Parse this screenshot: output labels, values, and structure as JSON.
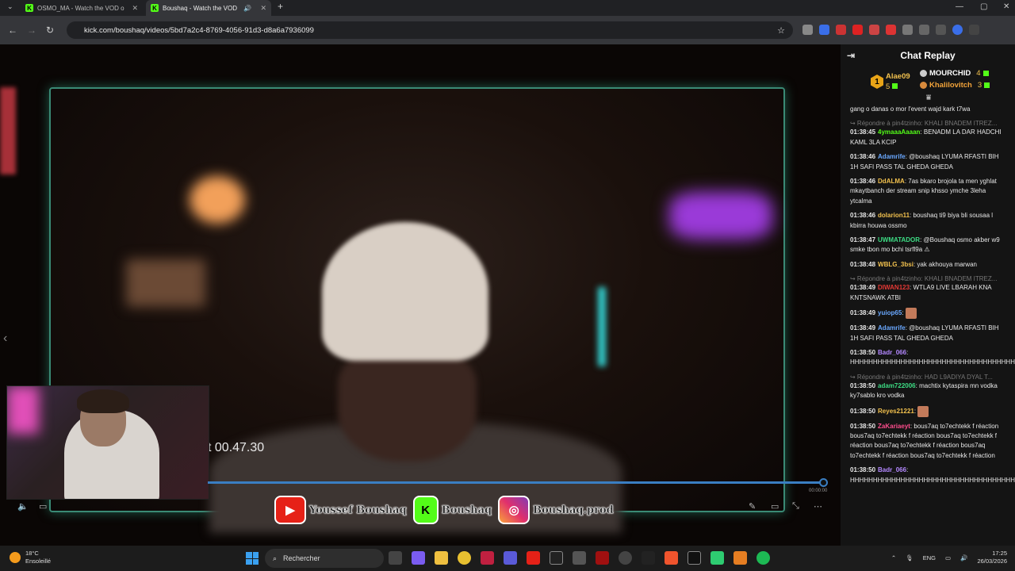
{
  "browser": {
    "tabs": [
      {
        "title": "OSMO_MA - Watch the VOD o",
        "active": false
      },
      {
        "title": "Boushaq - Watch the VOD",
        "active": true
      }
    ],
    "new_tab": "+",
    "url": "kick.com/boushaq/videos/5bd7a2c4-8769-4056-91d3-d8a6a7936099"
  },
  "video": {
    "timestamp_overlay": "t 00.47.30",
    "duration": "00:00:00",
    "social": [
      {
        "icon": "youtube-icon",
        "label": "Youssef Boushaq",
        "color": "#e62117"
      },
      {
        "icon": "kick-icon",
        "label": "Boushaq",
        "color": "#53fc18"
      },
      {
        "icon": "instagram-icon",
        "label": "Boushaq.prod",
        "color": "#c13584"
      }
    ]
  },
  "chat": {
    "title": "Chat Replay",
    "leaderboard": {
      "first": {
        "name": "Alae09",
        "count": "5",
        "rank": "1"
      },
      "second": {
        "name": "MOURCHID",
        "count": "4"
      },
      "third": {
        "name": "Khalilovitch",
        "count": "3"
      }
    },
    "messages": [
      {
        "ts": "",
        "user": "",
        "color": "#e8e8e8",
        "text": "gang o danas o mor l'event wajd kark t7wa",
        "reply": ""
      },
      {
        "ts": "01:38:45",
        "user": "4ymaaaAaaan",
        "color": "#53fc18",
        "text": "BENADM LA DAR HADCHI KAML 3LA KCIP",
        "reply": "↪ Répondre à pin4tzinho: KHALI BNADEM ITREZ..."
      },
      {
        "ts": "01:38:46",
        "user": "Adamrife",
        "color": "#6aa8ff",
        "text": "@boushaq LYUMA RFASTI BIH 1H SAFI PASS TAL GHEDA GHEDA",
        "reply": ""
      },
      {
        "ts": "01:38:46",
        "user": "DdALMA",
        "color": "#f2c14e",
        "text": "7as bkaro brojola ta men yghlat mkaytbanch der stream snip khsso ymche 3leha ytcalma",
        "reply": ""
      },
      {
        "ts": "01:38:46",
        "user": "dolarion11",
        "color": "#f2c14e",
        "text": "boushaq ti9 biya bli sousaa l kbirra houwa ossmo",
        "reply": ""
      },
      {
        "ts": "01:38:47",
        "user": "UWMATADOR",
        "color": "#3ddc84",
        "text": "@Boushaq osmo akber w9 smke tbon mo bchi tsrfl9a ⚠",
        "reply": ""
      },
      {
        "ts": "01:38:48",
        "user": "WBLG_3bsi",
        "color": "#f2c14e",
        "text": "yak akhouya marwan",
        "reply": ""
      },
      {
        "ts": "01:38:49",
        "user": "DIWAN123",
        "color": "#e53935",
        "text": "WTLA9 LIVE LBARAH KNA KNTSNAWK ATBI",
        "reply": "↪ Répondre à pin4tzinho: KHALI BNADEM ITREZ..."
      },
      {
        "ts": "01:38:49",
        "user": "yuiop65",
        "color": "#6aa8ff",
        "text": "",
        "reply": "",
        "emote": true
      },
      {
        "ts": "01:38:49",
        "user": "Adamrife",
        "color": "#6aa8ff",
        "text": "@boushaq LYUMA RFASTI BIH 1H SAFI PASS TAL GHEDA GHEDA",
        "reply": ""
      },
      {
        "ts": "01:38:50",
        "user": "Badr_066",
        "color": "#b388ff",
        "text": "HHHHHHHHHHHHHHHHHHHHHHHHHHHHHHHHHHHHHHHHHHHHHHJH",
        "reply": ""
      },
      {
        "ts": "01:38:50",
        "user": "adam722006",
        "color": "#3ddc84",
        "text": "machtix kytaspira mn vodka ky7sablo kro vodka",
        "reply": "↪ Répondre à pin4tzinho: HAD L9ADIYA DYAL T..."
      },
      {
        "ts": "01:38:50",
        "user": "Reyes21221",
        "color": "#f2c14e",
        "text": "",
        "reply": "",
        "emote": true
      },
      {
        "ts": "01:38:50",
        "user": "ZaKariaeyt",
        "color": "#ff4d8d",
        "text": "bous7aq to7echtekk f réaction bous7aq to7echtekk f réaction bous7aq to7echtekk f réaction bous7aq to7echtekk f réaction bous7aq to7echtekk f réaction bous7aq to7echtekk f réaction",
        "reply": ""
      },
      {
        "ts": "01:38:50",
        "user": "Badr_066",
        "color": "#b388ff",
        "text": "HHHHHHHHHHHHHHHHHHHHHHHHHHHHHHHHHHHHHHHHHHHHHHJH",
        "reply": ""
      }
    ]
  },
  "taskbar": {
    "weather_temp": "18°C",
    "weather_desc": "Ensoleillé",
    "search_placeholder": "Rechercher",
    "lang": "ENG",
    "time": "17:25",
    "date": "26/03/2026"
  }
}
